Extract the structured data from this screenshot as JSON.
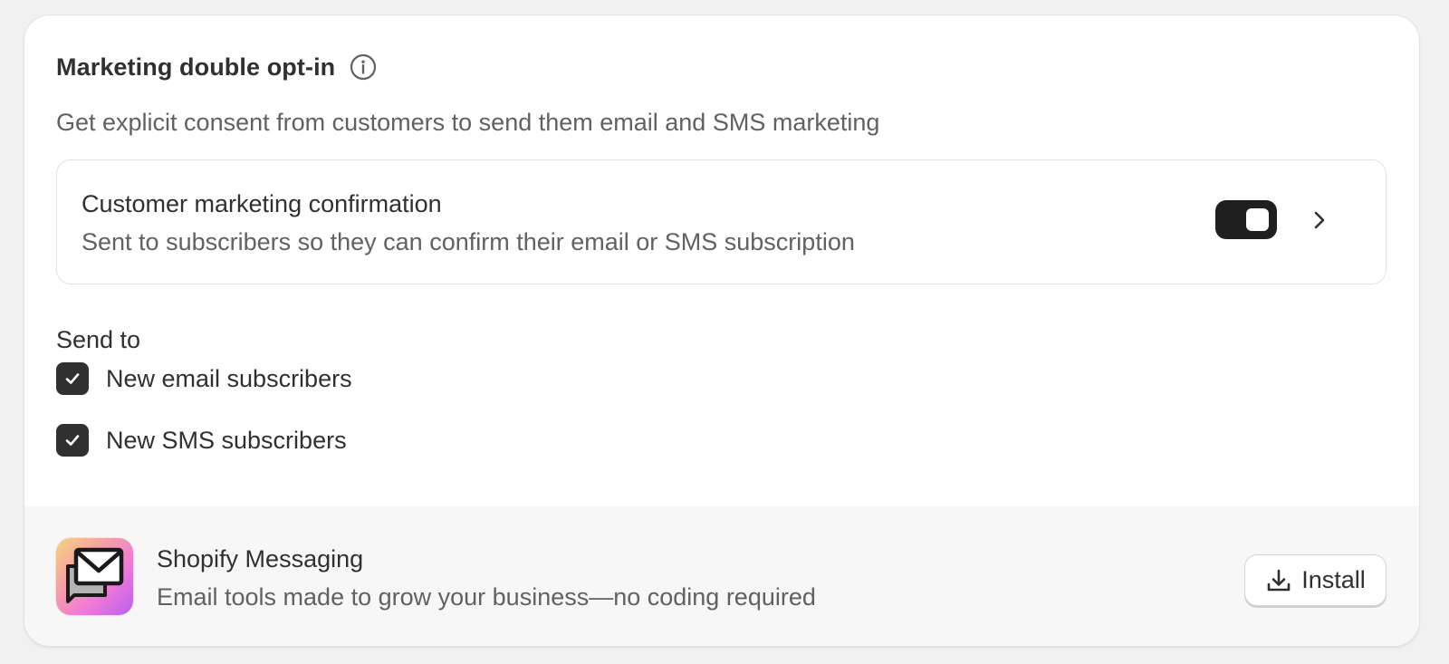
{
  "header": {
    "title": "Marketing double opt-in",
    "subtitle": "Get explicit consent from customers to send them email and SMS marketing",
    "info_icon": "info-icon"
  },
  "confirmation": {
    "title": "Customer marketing confirmation",
    "description": "Sent to subscribers so they can confirm their email or SMS subscription",
    "toggle_enabled": true,
    "chevron_icon": "chevron-right-icon"
  },
  "send_to": {
    "label": "Send to",
    "options": [
      {
        "label": "New email subscribers",
        "checked": true
      },
      {
        "label": "New SMS subscribers",
        "checked": true
      }
    ]
  },
  "promo": {
    "app_name": "Shopify Messaging",
    "app_description": "Email tools made to grow your business—no coding required",
    "install_label": "Install",
    "install_icon": "download-icon",
    "app_icon": "messaging-app-icon"
  },
  "colors": {
    "page_bg": "#f1f1f1",
    "card_bg": "#ffffff",
    "footer_bg": "#f7f7f7",
    "text_primary": "#303030",
    "text_secondary": "#616161",
    "toggle_on": "#1f1f1f"
  }
}
